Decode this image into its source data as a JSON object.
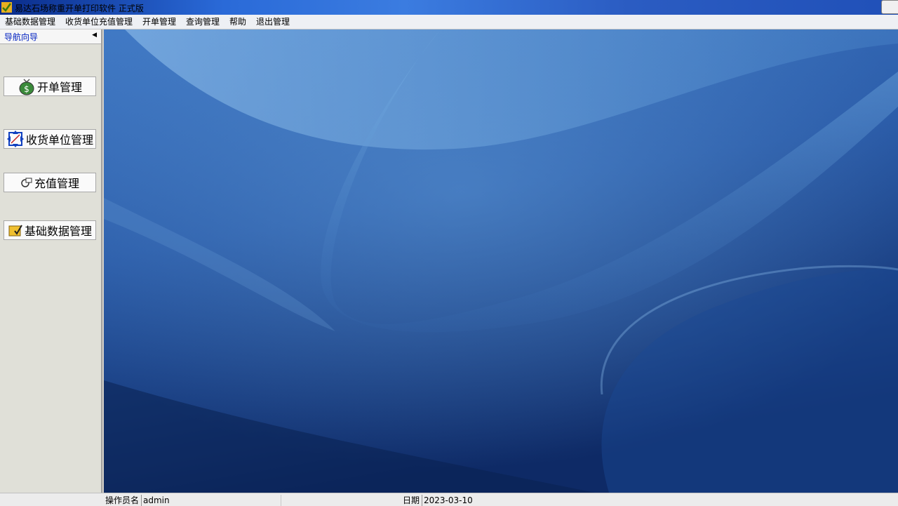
{
  "window": {
    "title": "易达石场称重开单打印软件 正式版",
    "icon": "app-checkmark-icon"
  },
  "menu": {
    "items": [
      "基础数据管理",
      "收货单位充值管理",
      "开单管理",
      "查询管理",
      "帮助",
      "退出管理"
    ]
  },
  "nav": {
    "title": "导航向导",
    "collapse_icon": "triangle-left-icon",
    "buttons": [
      {
        "label": "开单管理",
        "icon": "money-bag-icon"
      },
      {
        "label": "收货单位管理",
        "icon": "arrows-move-icon"
      },
      {
        "label": "充值管理",
        "icon": "recharge-icon"
      },
      {
        "label": "基础数据管理",
        "icon": "folder-check-icon"
      }
    ]
  },
  "status": {
    "operator_label": "操作员名",
    "operator_value": "admin",
    "date_label": "日期",
    "date_value": "2023-03-10"
  },
  "colors": {
    "nav_title": "#0020c0",
    "desktop_blue": "#2a5aa8"
  }
}
